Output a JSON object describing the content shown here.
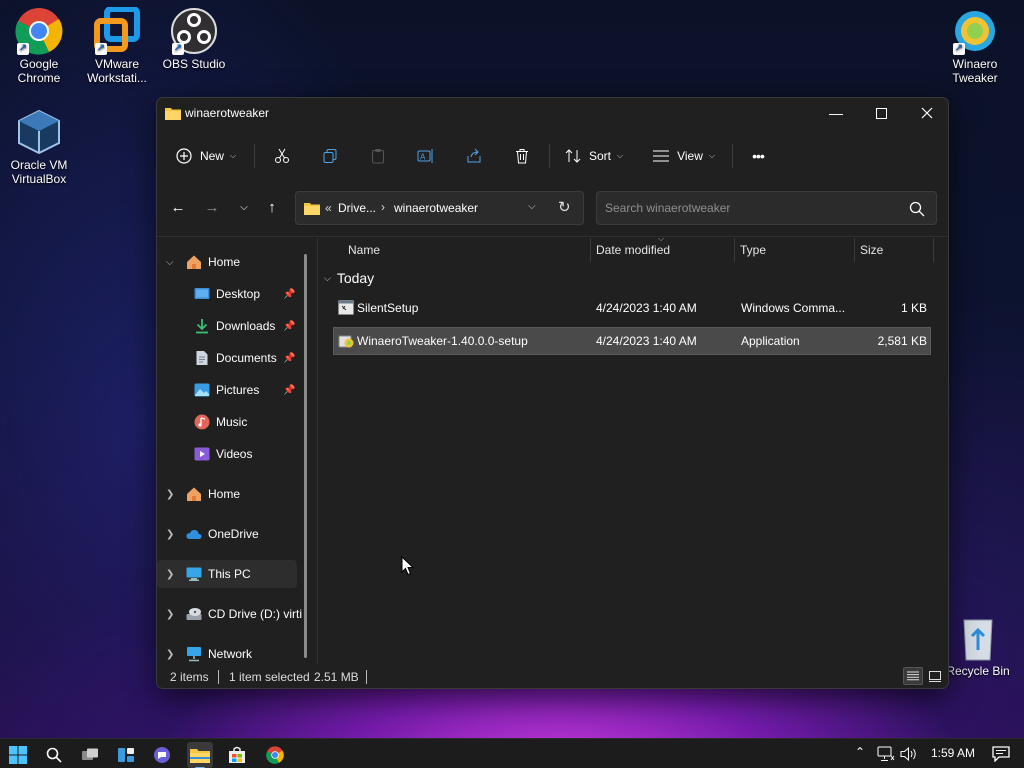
{
  "desktop": {
    "icons": [
      {
        "label": "Google Chrome"
      },
      {
        "label": "VMware Workstati..."
      },
      {
        "label": "OBS Studio"
      },
      {
        "label": "Winaero Tweaker"
      },
      {
        "label": "Oracle VM VirtualBox"
      },
      {
        "label": "Recycle Bin"
      }
    ]
  },
  "window": {
    "title": "winaerotweaker",
    "toolbar": {
      "new_label": "New",
      "sort_label": "Sort",
      "view_label": "View",
      "more_label": "•••"
    },
    "address": {
      "prefix": "«",
      "parent": "Drive...",
      "separator": "›",
      "current": "winaerotweaker"
    },
    "search": {
      "placeholder": "Search winaerotweaker"
    },
    "sidebar": {
      "items": [
        {
          "label": "Home"
        },
        {
          "label": "Desktop"
        },
        {
          "label": "Downloads"
        },
        {
          "label": "Documents"
        },
        {
          "label": "Pictures"
        },
        {
          "label": "Music"
        },
        {
          "label": "Videos"
        },
        {
          "label": "Home"
        },
        {
          "label": "OneDrive"
        },
        {
          "label": "This PC"
        },
        {
          "label": "CD Drive (D:) virti"
        },
        {
          "label": "Network"
        }
      ]
    },
    "columns": {
      "name": "Name",
      "date": "Date modified",
      "type": "Type",
      "size": "Size"
    },
    "group_label": "Today",
    "files": [
      {
        "name": "SilentSetup",
        "date": "4/24/2023 1:40 AM",
        "type": "Windows Comma...",
        "size": "1 KB"
      },
      {
        "name": "WinaeroTweaker-1.40.0.0-setup",
        "date": "4/24/2023 1:40 AM",
        "type": "Application",
        "size": "2,581 KB"
      }
    ],
    "status": {
      "items": "2 items",
      "selected": "1 item selected",
      "size": "2.51 MB"
    }
  },
  "taskbar": {
    "time": "1:59 AM"
  },
  "colors": {
    "accent": "#76b9ed",
    "folder": "#f4c542",
    "window_bg": "#202020"
  }
}
